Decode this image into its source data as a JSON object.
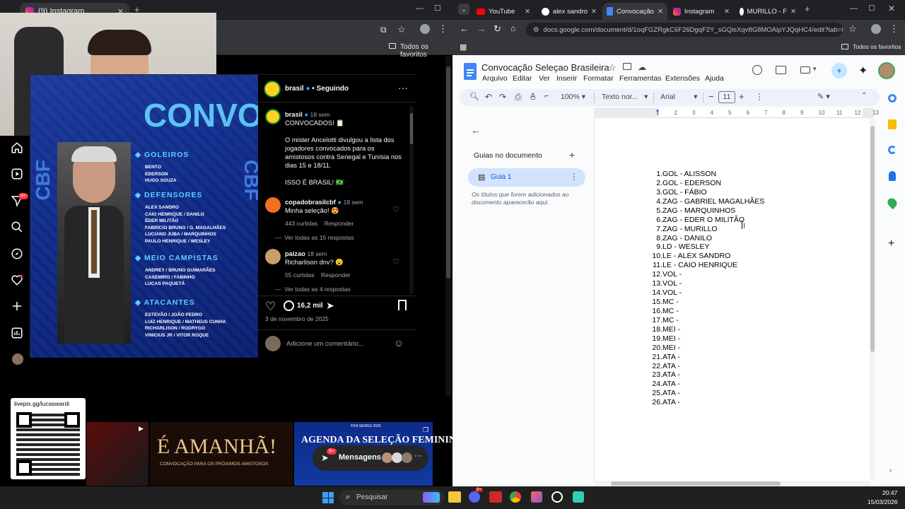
{
  "left_browser": {
    "tab_title": "(9) Instagram",
    "bookmark_label": "Todos os favoritos"
  },
  "instagram": {
    "nav_badge": "9+",
    "post": {
      "author": "brasil",
      "following_label": "Seguindo",
      "caption_author": "brasil",
      "caption_time": "18 sem",
      "caption_title": "CONVOCADOS! 📋",
      "caption_body": "O mister Ancelotti divulgou a lista dos jogadores convocados para os amistosos contra Senegal e Tunísia nos dias 15 e 18/11.",
      "caption_footer": "ISSO É BRASIL! 🇧🇷",
      "comments": [
        {
          "author": "copadobrasilcbf",
          "time": "18 sem",
          "text": "Minha seleção! 😍",
          "likes": "443 curtidas",
          "reply": "Responder",
          "view_replies": "Ver todas as 15 respostas"
        },
        {
          "author": "paizao",
          "time": "18 sem",
          "text": "Richarlison dnv? 😮",
          "likes": "55 curtidas",
          "reply": "Responder",
          "view_replies": "Ver todas as 4 respostas"
        }
      ],
      "likes_count": "16,2 mil",
      "date": "3 de novembro de 2025",
      "comment_placeholder": "Adicione um comentário..."
    },
    "image": {
      "header": "CONVOCAÇÃO",
      "categories": [
        {
          "title": "GOLEIROS",
          "names": [
            "BENTO",
            "EDERSON",
            "HUGO SOUZA"
          ]
        },
        {
          "title": "DEFENSORES",
          "names": [
            "ALEX SANDRO",
            "CAIO HENRIQUE / DANILO",
            "ÉDER MILITÃO",
            "FABRÍCIO BRUNO / G. MAGALHÃES",
            "LUCIANO JUBA / MARQUINHOS",
            "PAULO HENRIQUE / WESLEY"
          ]
        },
        {
          "title": "MEIO CAMPISTAS",
          "names": [
            "ANDREY / BRUNO GUIMARÃES",
            "CASEMIRO / FABINHO",
            "LUCAS PAQUETÁ"
          ]
        },
        {
          "title": "ATACANTES",
          "names": [
            "ESTEVÃO / JOÃO PEDRO",
            "LUIZ HENRIQUE / MATHEUS CUNHA",
            "RICHARLISON / RODRYGO",
            "VINICIUS JR / VITOR ROQUE"
          ]
        }
      ],
      "side_text": "CBF"
    },
    "messages_label": "Mensagens",
    "messages_badge": "9+",
    "livepix_url": "livepix.gg/lucaswardi",
    "banner_1": "É AMANHÃ!",
    "banner_1_sub": "CONVOCAÇÃO PARA OS PRÓXIMOS AMISTOSOS",
    "banner_2": "AGENDA DA SELEÇÃO FEMININA",
    "banner_2_top": "FIFA SERIES 2026"
  },
  "right_browser": {
    "tabs": [
      "YouTube",
      "alex sandro",
      "Convocação",
      "Instagram",
      "MURILLO - F"
    ],
    "url": "docs.google.com/document/d/1oqFGZRgkC6F26DgqF2Y_sGQisXqv8G8MOAipYJQqHC4/edit?tab=t.0",
    "bookmark_label": "Todos os favoritos"
  },
  "docs": {
    "title": "Convocação Seleçao Brasileira",
    "menus": [
      "Arquivo",
      "Editar",
      "Ver",
      "Inserir",
      "Formatar",
      "Ferramentas",
      "Extensões",
      "Ajuda"
    ],
    "toolbar": {
      "zoom": "100%",
      "style": "Texto nor...",
      "font": "Arial",
      "font_size": "11"
    },
    "sidebar": {
      "heading": "Guias no documento",
      "tab_name": "Guia 1",
      "hint": "Os títulos que forem adicionados ao documento aparecerão aqui."
    },
    "ruler_marks": [
      "1",
      "2",
      "3",
      "4",
      "5",
      "6",
      "7",
      "8",
      "9",
      "10",
      "11",
      "12",
      "13"
    ],
    "list": [
      {
        "n": "1.",
        "t": "GOL - ALISSON"
      },
      {
        "n": "2.",
        "t": "GOL - EDERSON"
      },
      {
        "n": "3.",
        "t": "GOL - FÁBIO"
      },
      {
        "n": "4.",
        "t": "ZAG - GABRIEL MAGALHÃES"
      },
      {
        "n": "5.",
        "t": "ZAG - MARQUINHOS"
      },
      {
        "n": "6.",
        "t": "ZAG - EDER O MILITÃO"
      },
      {
        "n": "7.",
        "t": "ZAG - MURILLO"
      },
      {
        "n": "8.",
        "t": "ZAG - DANILO"
      },
      {
        "n": "9.",
        "t": "LD - WESLEY"
      },
      {
        "n": "10.",
        "t": "LE - ALEX SANDRO"
      },
      {
        "n": "11.",
        "t": "LE - CAIO HENRIQUE"
      },
      {
        "n": "12.",
        "t": "VOL -"
      },
      {
        "n": "13.",
        "t": "VOL -"
      },
      {
        "n": "14.",
        "t": "VOL -"
      },
      {
        "n": "15.",
        "t": "MC -"
      },
      {
        "n": "16.",
        "t": "MC -"
      },
      {
        "n": "17.",
        "t": "MC -"
      },
      {
        "n": "18.",
        "t": "MEI -"
      },
      {
        "n": "19.",
        "t": "MEI -"
      },
      {
        "n": "20.",
        "t": "MEI -"
      },
      {
        "n": "21.",
        "t": "ATA -"
      },
      {
        "n": "22.",
        "t": "ATA -"
      },
      {
        "n": "23.",
        "t": "ATA -"
      },
      {
        "n": "24.",
        "t": "ATA -"
      },
      {
        "n": "25.",
        "t": "ATA -"
      },
      {
        "n": "26.",
        "t": "ATA -"
      }
    ]
  },
  "taskbar": {
    "search_placeholder": "Pesquisar",
    "time": "20:47",
    "date": "15/03/2026",
    "badge": "9+"
  },
  "colors": {
    "docs_blue": "#1a73e8",
    "ig_blue_bg": "#0f2a88",
    "ig_accent": "#5ad1ff",
    "taskbar": "#202020"
  }
}
